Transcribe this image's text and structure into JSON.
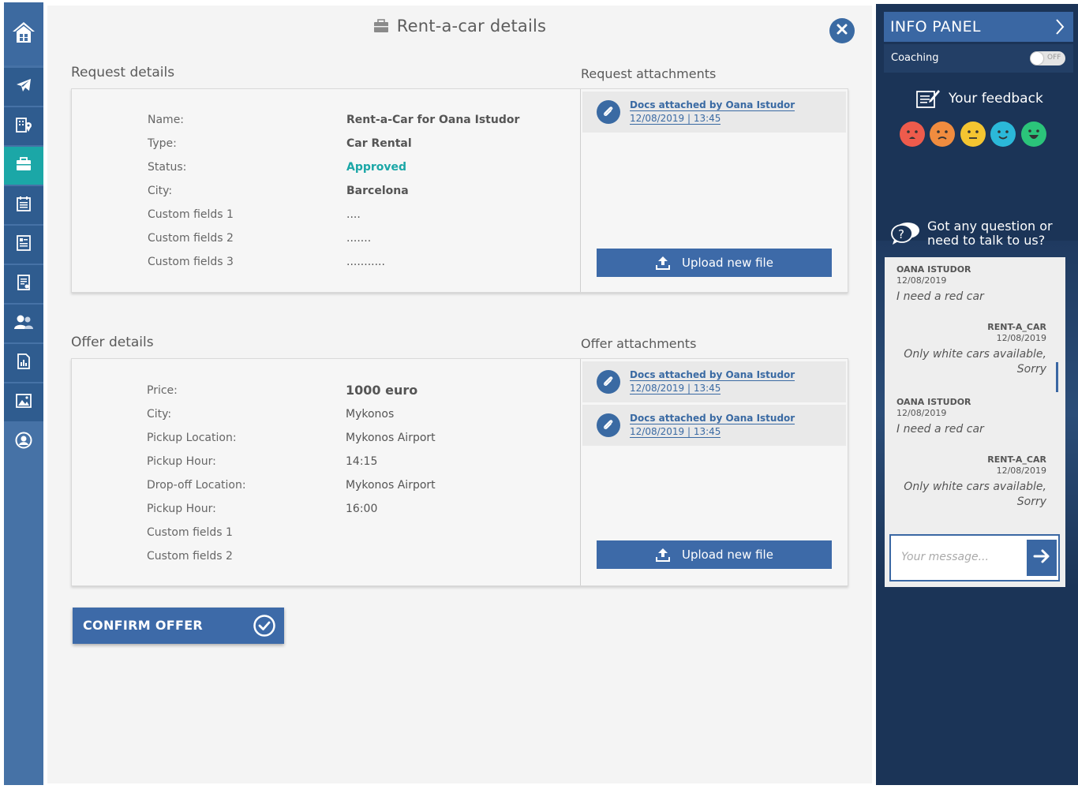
{
  "title": "Rent-a-car details",
  "request": {
    "section_title": "Request details",
    "attachments_title": "Request attachments",
    "rows": [
      {
        "label": "Name:",
        "value": "Rent-a-Car for Oana Istudor"
      },
      {
        "label": "Type:",
        "value": "Car Rental"
      },
      {
        "label": "Status:",
        "value": "Approved"
      },
      {
        "label": "City:",
        "value": "Barcelona"
      },
      {
        "label": "Custom fields 1",
        "value": "...."
      },
      {
        "label": "Custom fields 2",
        "value": "......."
      },
      {
        "label": "Custom fields 3",
        "value": "..........."
      }
    ],
    "attachments": [
      {
        "title": "Docs attached by Oana Istudor",
        "date": "12/08/2019  |  13:45"
      }
    ],
    "upload_label": "Upload new file"
  },
  "offer": {
    "section_title": "Offer details",
    "attachments_title": "Offer attachments",
    "rows": [
      {
        "label": "Price:",
        "value": "1000 euro"
      },
      {
        "label": "City:",
        "value": "Mykonos"
      },
      {
        "label": "Pickup Location:",
        "value": "Mykonos Airport"
      },
      {
        "label": "Pickup Hour:",
        "value": "14:15"
      },
      {
        "label": "Drop-off Location:",
        "value": "Mykonos Airport"
      },
      {
        "label": "Pickup Hour:",
        "value": "16:00"
      },
      {
        "label": "Custom fields 1",
        "value": ""
      },
      {
        "label": "Custom fields 2",
        "value": ""
      }
    ],
    "attachments": [
      {
        "title": "Docs attached by Oana Istudor",
        "date": "12/08/2019  |  13:45"
      },
      {
        "title": "Docs attached by Oana Istudor",
        "date": "12/08/2019  |  13:45"
      }
    ],
    "upload_label": "Upload new file"
  },
  "confirm_label": "CONFIRM OFFER",
  "info_panel": {
    "title": "INFO PANEL",
    "coaching_label": "Coaching",
    "toggle_text": "OFF",
    "feedback_label": "Your feedback",
    "emoji_colors": [
      "#ee5b4c",
      "#f08c3f",
      "#f4c531",
      "#2bb8d9",
      "#2bc47a"
    ],
    "question_text": "Got any question or need to talk to us?",
    "messages": [
      {
        "who": "OANA ISTUDOR",
        "when": "12/08/2019",
        "body": "I need a red car"
      },
      {
        "who": "RENT-A_CAR",
        "when": "12/08/2019",
        "body": "Only white cars available, Sorry"
      },
      {
        "who": "OANA ISTUDOR",
        "when": "12/08/2019",
        "body": "I need a red car"
      },
      {
        "who": "RENT-A_CAR",
        "when": "12/08/2019",
        "body": "Only white cars available, Sorry"
      }
    ],
    "message_placeholder": "Your message..."
  },
  "nav_icons": [
    "home-icon",
    "flight-icon",
    "hotel-icon",
    "briefcase-icon",
    "calendar-icon",
    "list-icon",
    "report-icon",
    "users-icon",
    "chart-icon",
    "gallery-icon",
    "profile-icon"
  ]
}
